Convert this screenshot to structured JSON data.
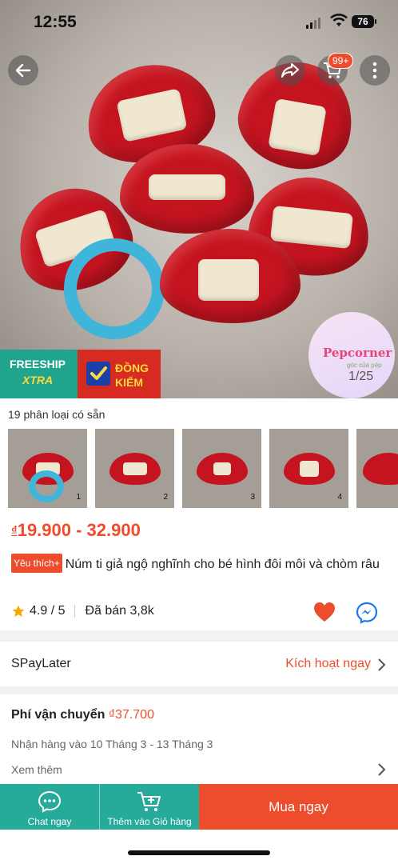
{
  "status_bar": {
    "time": "12:55",
    "battery": "76"
  },
  "header": {
    "cart_badge": "99+",
    "back_icon": "back-arrow-icon",
    "share_icon": "share-icon",
    "cart_icon": "cart-icon",
    "more_icon": "more-vertical-icon"
  },
  "gallery": {
    "counter": "1/25",
    "shop_logo": "Pepcorner",
    "shop_logo_sub": "góc của pép"
  },
  "badges": {
    "freeship_line1": "FREESHIP",
    "freeship_line2": "XTRA",
    "dongkiem_line1": "ĐỒNG",
    "dongkiem_line2": "KIỂM"
  },
  "variants": {
    "label": "19 phân loại có sẵn",
    "thumbnails": [
      "1",
      "2",
      "3",
      "4",
      ""
    ]
  },
  "product": {
    "currency": "₫",
    "price_range": "19.900 - 32.900",
    "fav_tag": "Yêu thích+",
    "title": "Núm ti giả ngộ nghĩnh cho bé hình đôi môi và chòm râu",
    "rating": "4.9 / 5",
    "sold": "Đã bán 3,8k"
  },
  "spaylater": {
    "label": "SPayLater",
    "action": "Kích hoạt ngay"
  },
  "shipping": {
    "label": "Phí vận chuyển",
    "price": "₫37.700",
    "delivery": "Nhận hàng vào 10 Tháng 3 - 13 Tháng 3",
    "see_more": "Xem thêm"
  },
  "bottom_bar": {
    "chat": "Chat ngay",
    "add_to_cart": "Thêm vào Giỏ hàng",
    "buy_now": "Mua ngay"
  },
  "colors": {
    "accent": "#ee4d2d",
    "teal": "#26aa99"
  }
}
